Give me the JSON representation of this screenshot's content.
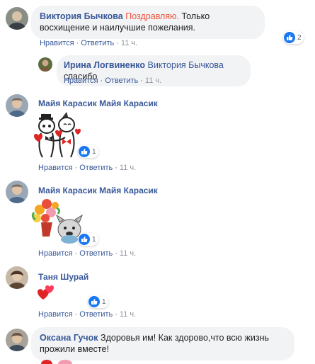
{
  "comments": [
    {
      "author": "Виктория Бычкова",
      "highlight": "Поздравляю.",
      "text": " Только восхищение и наилучшие пожелания.",
      "reactions": "2",
      "like": "Нравится",
      "reply": "Ответить",
      "time": "11 ч."
    },
    {
      "author": "Ирина Логвиненко",
      "mention": "Виктория Бычкова",
      "text": " спасибо",
      "like": "Нравится",
      "reply": "Ответить",
      "time": "11 ч."
    },
    {
      "author": "Майя Карасик Майя Карасик",
      "sticker": "cats-couple-sticker",
      "reactions": "1",
      "like": "Нравится",
      "reply": "Ответить",
      "time": "11 ч."
    },
    {
      "author": "Майя Карасик Майя Карасик",
      "sticker": "bulldog-with-flowers-sticker",
      "reactions": "1",
      "like": "Нравится",
      "reply": "Ответить",
      "time": "11 ч."
    },
    {
      "author": "Таня Шурай",
      "sticker": "two-hearts-sticker",
      "reactions": "1",
      "like": "Нравится",
      "reply": "Ответить",
      "time": "11 ч."
    },
    {
      "author": "Оксана Гучок",
      "text": "Здоровья им! Как здорово,что всю жизнь прожили вместе!"
    }
  ],
  "separator": "·",
  "colors": {
    "link": "#385898",
    "bubble": "#f2f3f5",
    "like": "#1877f2",
    "highlight": "#e9573f"
  }
}
